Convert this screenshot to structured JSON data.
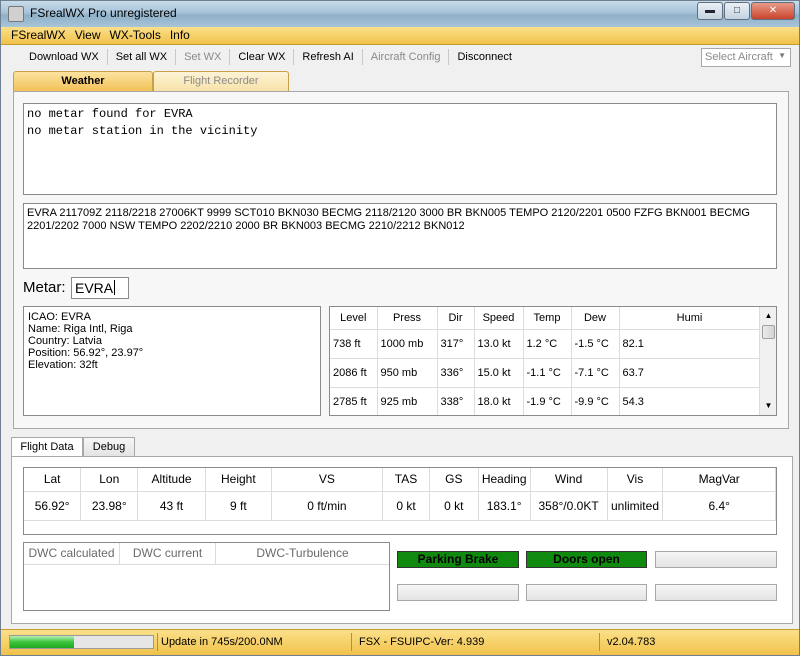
{
  "window": {
    "title": "FSrealWX Pro unregistered"
  },
  "menu": [
    "FSrealWX",
    "View",
    "WX-Tools",
    "Info"
  ],
  "toolbar": {
    "buttons": [
      {
        "label": "Download WX",
        "enabled": true
      },
      {
        "label": "Set all WX",
        "enabled": true
      },
      {
        "label": "Set  WX",
        "enabled": false
      },
      {
        "label": "Clear WX",
        "enabled": true
      },
      {
        "label": "Refresh AI",
        "enabled": true
      },
      {
        "label": "Aircraft Config",
        "enabled": false
      },
      {
        "label": "Disconnect",
        "enabled": true
      }
    ],
    "aircraft_select": "Select Aircraft"
  },
  "top_tabs": [
    {
      "label": "Weather",
      "active": true
    },
    {
      "label": "Flight Recorder",
      "active": false
    }
  ],
  "metar_text": [
    "no metar found for EVRA",
    "no metar station in the vicinity"
  ],
  "taf_text": "EVRA 211709Z 2118/2218 27006KT 9999 SCT010 BKN030    BECMG 2118/2120 3000 BR BKN005    TEMPO 2120/2201 0500 FZFG BKN001    BECMG 2201/2202 7000 NSW    TEMPO 2202/2210 2000 BR BKN003    BECMG 2210/2212 BKN012",
  "metar_field": {
    "label": "Metar:",
    "value": "EVRA"
  },
  "station": {
    "icao": "ICAO: EVRA",
    "name": "Name: Riga Intl, Riga",
    "country": "Country: Latvia",
    "position": "Position: 56.92°, 23.97°",
    "elevation": "Elevation: 32ft"
  },
  "levels": {
    "headers": [
      "Level",
      "Press",
      "Dir",
      "Speed",
      "Temp",
      "Dew",
      "Humi"
    ],
    "rows": [
      [
        "738 ft",
        "1000 mb",
        "317°",
        "13.0 kt",
        "1.2 °C",
        "-1.5 °C",
        "82.1"
      ],
      [
        "2086 ft",
        "950 mb",
        "336°",
        "15.0 kt",
        "-1.1 °C",
        "-7.1 °C",
        "63.7"
      ],
      [
        "2785 ft",
        "925 mb",
        "338°",
        "18.0 kt",
        "-1.9 °C",
        "-9.9 °C",
        "54.3"
      ]
    ]
  },
  "bottom_tabs": [
    {
      "label": "Flight Data",
      "active": true
    },
    {
      "label": "Debug",
      "active": false
    }
  ],
  "flight_data": {
    "headers": [
      "Lat",
      "Lon",
      "Altitude",
      "Height",
      "VS",
      "TAS",
      "GS",
      "Heading",
      "Wind",
      "Vis",
      "MagVar"
    ],
    "values": [
      "56.92°",
      "23.98°",
      "43 ft",
      "9 ft",
      "0 ft/min",
      "0 kt",
      "0 kt",
      "183.1°",
      "358°/0.0KT",
      "unlimited",
      "6.4°"
    ]
  },
  "dwc": {
    "headers": [
      "DWC calculated",
      "DWC current",
      "DWC-Turbulence"
    ]
  },
  "indicators": {
    "parking_brake": "Parking Brake",
    "doors": "Doors open"
  },
  "status": {
    "progress_percent": 45,
    "update": "Update in 745s/200.0NM",
    "fsx": "FSX - FSUIPC-Ver: 4.939",
    "version": "v2.04.783"
  },
  "colors": {
    "accent": "#f2c158",
    "indicator_on": "#0f8a0f"
  }
}
